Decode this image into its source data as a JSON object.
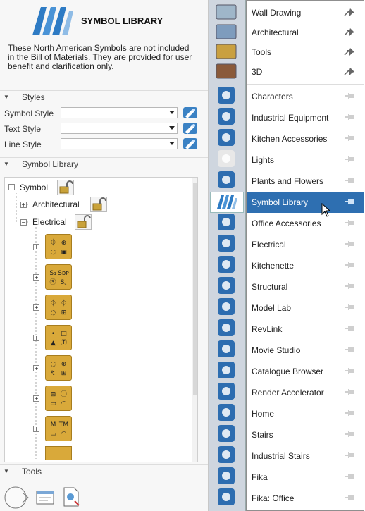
{
  "header": {
    "title": "SYMBOL LIBRARY",
    "note": "These North American Symbols are not included in the Bill of Materials. They are provided for user benefit and clarification only."
  },
  "sections": {
    "styles": "Styles",
    "symbol_library": "Symbol Library",
    "tools": "Tools"
  },
  "styles": {
    "symbol_style": {
      "label": "Symbol Style",
      "value": ""
    },
    "text_style": {
      "label": "Text Style",
      "value": ""
    },
    "line_style": {
      "label": "Line Style",
      "value": ""
    }
  },
  "tree": {
    "root": "Symbol",
    "architectural": "Architectural",
    "electrical": "Electrical",
    "folder_glyphs": [
      [
        "⏀",
        "⊕",
        "◌",
        "▣"
      ],
      [
        "S₃",
        "Sᴅᴘ",
        "Ⓢ",
        "S꜀"
      ],
      [
        "⏀",
        "⏀",
        "◌",
        "⊞"
      ],
      [
        "•",
        "□",
        "▲",
        "Ⓣ"
      ],
      [
        "◌",
        "⊕",
        "↯",
        "⊞"
      ],
      [
        "⊟",
        "Ⓛ",
        "▭",
        "◠"
      ],
      [
        "M",
        "TM",
        "▭",
        "◠"
      ]
    ]
  },
  "menu": {
    "pinned": [
      "Wall Drawing",
      "Architectural",
      "Tools",
      "3D"
    ],
    "items": [
      "Characters",
      "Industrial Equipment",
      "Kitchen Accessories",
      "Lights",
      "Plants and Flowers",
      "Symbol Library",
      "Office Accessories",
      "Electrical",
      "Kitchenette",
      "Structural",
      "Model Lab",
      "RevLink",
      "Movie Studio",
      "Catalogue Browser",
      "Render Accelerator",
      "Home",
      "Stairs",
      "Industrial Stairs",
      "Fika",
      "Fika: Office"
    ],
    "selected": "Symbol Library"
  },
  "colors": {
    "accent": "#2e6fb1",
    "folder": "#d9a93a",
    "strip": "#cfd6df"
  }
}
